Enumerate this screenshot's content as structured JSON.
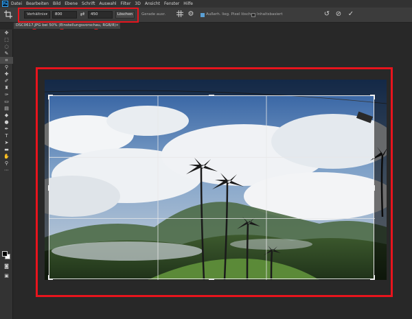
{
  "app": {
    "logo": "Ps"
  },
  "menu": [
    "Datei",
    "Bearbeiten",
    "Bild",
    "Ebene",
    "Schrift",
    "Auswahl",
    "Filter",
    "3D",
    "Ansicht",
    "Fenster",
    "Hilfe"
  ],
  "options": {
    "ratio_mode": "Verhältnis",
    "width": "800",
    "height": "450",
    "clear_label": "Löschen",
    "straighten_label": "Gerade ausr.",
    "delete_cropped_label": "Außerh. lieg. Pixel löschen",
    "delete_cropped_checked": true,
    "content_aware_label": "Inhaltsbasiert",
    "content_aware_checked": false
  },
  "document_tab": {
    "title": "DSC0617.JPG bei 50% (Einstellungsvorschau, RGB/8)",
    "close": "×"
  },
  "colors": {
    "highlight": "#e8141d",
    "panel": "#323232",
    "canvas_bg": "#282828"
  },
  "icons": [
    "crop-icon",
    "swap-icon",
    "grid-overlay-icon",
    "gear-icon",
    "reset-icon",
    "cancel-icon",
    "commit-icon"
  ]
}
